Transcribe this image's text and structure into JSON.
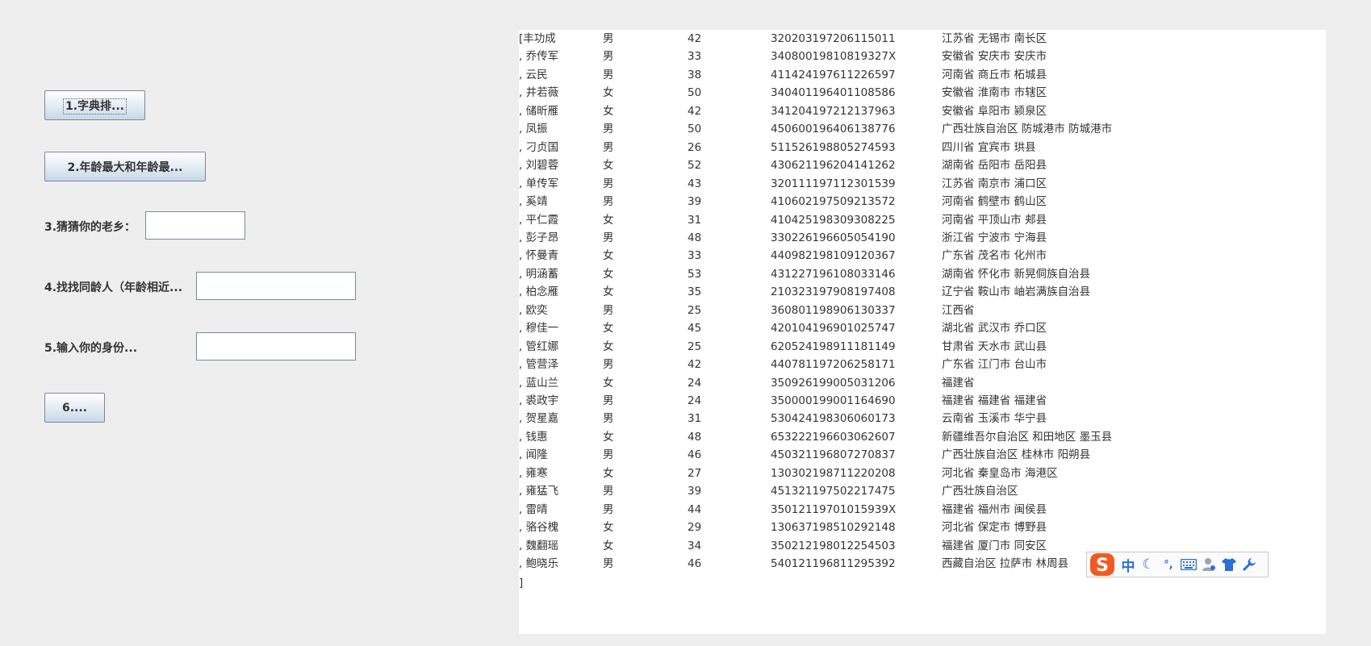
{
  "controls": {
    "btn1_label": "1.字典排...",
    "btn2_label": "2.年龄最大和年龄最...",
    "label3": "3.猜猜你的老乡：",
    "input3_value": "",
    "label4": "4.找找同龄人（年龄相近...",
    "input4_value": "",
    "label5": "5.输入你的身份...",
    "input5_value": "",
    "btn6_label": "6...."
  },
  "output": {
    "rows": [
      {
        "prefix": "[",
        "name": "丰功成",
        "gender": "男",
        "age": "42",
        "id": "320203197206115011",
        "addr": "江苏省 无锡市 南长区"
      },
      {
        "prefix": ", ",
        "name": "乔传军",
        "gender": "男",
        "age": "33",
        "id": "34080019810819327X",
        "addr": "安徽省 安庆市 安庆市"
      },
      {
        "prefix": ", ",
        "name": "云民",
        "gender": "男",
        "age": "38",
        "id": "411424197611226597",
        "addr": "河南省 商丘市 柘城县"
      },
      {
        "prefix": ", ",
        "name": "井若薇",
        "gender": "女",
        "age": "50",
        "id": "340401196401108586",
        "addr": "安徽省 淮南市 市辖区"
      },
      {
        "prefix": ", ",
        "name": "储昕雁",
        "gender": "女",
        "age": "42",
        "id": "341204197212137963",
        "addr": "安徽省 阜阳市 颍泉区"
      },
      {
        "prefix": ", ",
        "name": "凤振",
        "gender": "男",
        "age": "50",
        "id": "450600196406138776",
        "addr": "广西壮族自治区 防城港市 防城港市"
      },
      {
        "prefix": ", ",
        "name": "刁贞国",
        "gender": "男",
        "age": "26",
        "id": "511526198805274593",
        "addr": "四川省 宜宾市 珙县"
      },
      {
        "prefix": ", ",
        "name": "刘碧蓉",
        "gender": "女",
        "age": "52",
        "id": "430621196204141262",
        "addr": "湖南省 岳阳市 岳阳县"
      },
      {
        "prefix": ", ",
        "name": "单传军",
        "gender": "男",
        "age": "43",
        "id": "320111197112301539",
        "addr": "江苏省 南京市 浦口区"
      },
      {
        "prefix": ", ",
        "name": "奚靖",
        "gender": "男",
        "age": "39",
        "id": "410602197509213572",
        "addr": "河南省 鹤壁市 鹤山区"
      },
      {
        "prefix": ", ",
        "name": "平仁霞",
        "gender": "女",
        "age": "31",
        "id": "410425198309308225",
        "addr": "河南省 平顶山市 郏县"
      },
      {
        "prefix": ", ",
        "name": "彭子昂",
        "gender": "男",
        "age": "48",
        "id": "330226196605054190",
        "addr": "浙江省 宁波市 宁海县"
      },
      {
        "prefix": ", ",
        "name": "怀曼青",
        "gender": "女",
        "age": "33",
        "id": "440982198109120367",
        "addr": "广东省 茂名市 化州市"
      },
      {
        "prefix": ", ",
        "name": "明涵蓄",
        "gender": "女",
        "age": "53",
        "id": "431227196108033146",
        "addr": "湖南省 怀化市 新晃侗族自治县"
      },
      {
        "prefix": ", ",
        "name": "柏念雁",
        "gender": "女",
        "age": "35",
        "id": "210323197908197408",
        "addr": "辽宁省 鞍山市 岫岩满族自治县"
      },
      {
        "prefix": ", ",
        "name": "欧奕",
        "gender": "男",
        "age": "25",
        "id": "360801198906130337",
        "addr": "江西省"
      },
      {
        "prefix": ", ",
        "name": "穆佳一",
        "gender": "女",
        "age": "45",
        "id": "420104196901025747",
        "addr": "湖北省 武汉市 乔口区"
      },
      {
        "prefix": ", ",
        "name": "管红娜",
        "gender": "女",
        "age": "25",
        "id": "620524198911181149",
        "addr": "甘肃省 天水市 武山县"
      },
      {
        "prefix": ", ",
        "name": "管营泽",
        "gender": "男",
        "age": "42",
        "id": "440781197206258171",
        "addr": "广东省 江门市 台山市"
      },
      {
        "prefix": ", ",
        "name": "蓝山兰",
        "gender": "女",
        "age": "24",
        "id": "350926199005031206",
        "addr": "福建省"
      },
      {
        "prefix": ", ",
        "name": "裘政宇",
        "gender": "男",
        "age": "24",
        "id": "350000199001164690",
        "addr": "福建省 福建省 福建省"
      },
      {
        "prefix": ", ",
        "name": "贺星嘉",
        "gender": "男",
        "age": "31",
        "id": "530424198306060173",
        "addr": "云南省 玉溪市 华宁县"
      },
      {
        "prefix": ", ",
        "name": "钱惠",
        "gender": "女",
        "age": "48",
        "id": "653222196603062607",
        "addr": "新疆维吾尔自治区 和田地区 墨玉县"
      },
      {
        "prefix": ", ",
        "name": "闻隆",
        "gender": "男",
        "age": "46",
        "id": "450321196807270837",
        "addr": "广西壮族自治区 桂林市 阳朔县"
      },
      {
        "prefix": ", ",
        "name": "雍寒",
        "gender": "女",
        "age": "27",
        "id": "130302198711220208",
        "addr": "河北省 秦皇岛市 海港区"
      },
      {
        "prefix": ", ",
        "name": "雍猛飞",
        "gender": "男",
        "age": "39",
        "id": "451321197502217475",
        "addr": "广西壮族自治区"
      },
      {
        "prefix": ", ",
        "name": "雷晴",
        "gender": "男",
        "age": "44",
        "id": "35012119701015939X",
        "addr": "福建省 福州市 闽侯县"
      },
      {
        "prefix": ", ",
        "name": "骆谷槐",
        "gender": "女",
        "age": "29",
        "id": "130637198510292148",
        "addr": "河北省 保定市 博野县"
      },
      {
        "prefix": ", ",
        "name": "魏翻瑶",
        "gender": "女",
        "age": "34",
        "id": "350212198012254503",
        "addr": "福建省 厦门市 同安区"
      },
      {
        "prefix": ", ",
        "name": "鲍晓乐",
        "gender": "男",
        "age": "46",
        "id": "540121196811295392",
        "addr": "西藏自治区 拉萨市 林周县"
      }
    ],
    "closing": "]"
  },
  "ime_toolbar": {
    "logo_icon": "sogou-s-logo-icon",
    "items": [
      {
        "icon": "chinese-mode-icon",
        "text": "中"
      },
      {
        "icon": "moon-icon",
        "text": "☾"
      },
      {
        "icon": "punctuation-icon",
        "text": "°,"
      },
      {
        "icon": "keyboard-icon",
        "text": ""
      },
      {
        "icon": "user-icon",
        "text": ""
      },
      {
        "icon": "shirt-icon",
        "text": ""
      },
      {
        "icon": "wrench-icon",
        "text": ""
      }
    ],
    "colors": {
      "logo": "#f05a22",
      "icons": "#2a6fd6"
    }
  }
}
